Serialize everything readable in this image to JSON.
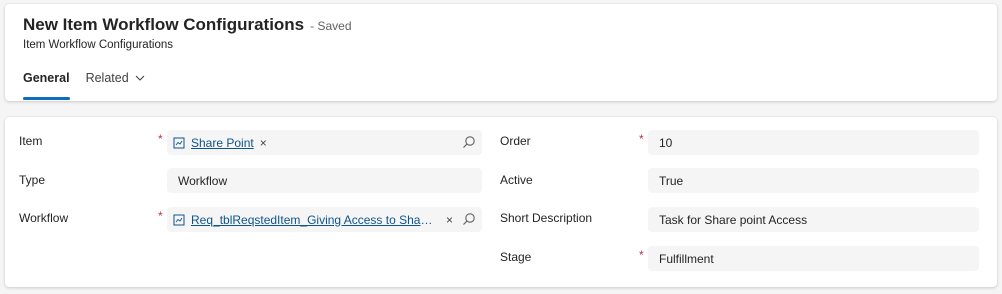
{
  "header": {
    "title": "New Item Workflow Configurations",
    "status": "- Saved",
    "subtitle": "Item Workflow Configurations",
    "tabs": [
      {
        "label": "General"
      },
      {
        "label": "Related"
      }
    ]
  },
  "form": {
    "left": [
      {
        "label": "Item",
        "required": "*",
        "lookup_value": "Share Point",
        "clear": "×"
      },
      {
        "label": "Type",
        "value": "Workflow"
      },
      {
        "label": "Workflow",
        "required": "*",
        "lookup_value": "Req_tblReqstedItem_Giving Access to SharePoi...",
        "clear": "×"
      }
    ],
    "right": [
      {
        "label": "Order",
        "required": "*",
        "value": "10"
      },
      {
        "label": "Active",
        "value": "True"
      },
      {
        "label": "Short Description",
        "value": "Task for Share point Access"
      },
      {
        "label": "Stage",
        "required": "*",
        "value": "Fulfillment"
      }
    ]
  },
  "icons": {
    "lookup_entity": "entity-record-icon",
    "search": "search-icon",
    "tab_dropdown": "chevron-down-icon"
  },
  "colors": {
    "accent": "#0f6cbd",
    "link": "#0f548c",
    "required": "#c4314b",
    "field_bg": "#f5f5f5"
  }
}
